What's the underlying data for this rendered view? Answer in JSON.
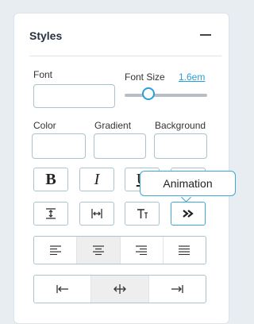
{
  "panel": {
    "title": "Styles",
    "collapse_icon": "minus-icon"
  },
  "font": {
    "label": "Font",
    "value": ""
  },
  "font_size": {
    "label": "Font Size",
    "value": "1.6em",
    "slider_level": 0.28
  },
  "color": {
    "label": "Color",
    "value": ""
  },
  "gradient": {
    "label": "Gradient",
    "value": ""
  },
  "background": {
    "label": "Background",
    "value": ""
  },
  "format_buttons": {
    "bold": "B",
    "italic": "I",
    "underline": "U"
  },
  "icons": {
    "line_height": "line-height-icon",
    "letter_spacing": "letter-spacing-icon",
    "text_style": "text-style-icon",
    "animation": "double-chevron-right-icon",
    "align_left": "align-left-icon",
    "align_center": "align-center-icon",
    "align_right": "align-right-icon",
    "align_justify": "align-justify-icon",
    "position_left": "arrow-to-left-icon",
    "position_center": "arrows-horizontal-icon",
    "position_right": "arrow-to-right-icon"
  },
  "tooltip": {
    "text": "Animation"
  },
  "colors": {
    "accent": "#2b9ed8",
    "border": "#a9c3cf",
    "selected_bg": "#eeeeee"
  }
}
